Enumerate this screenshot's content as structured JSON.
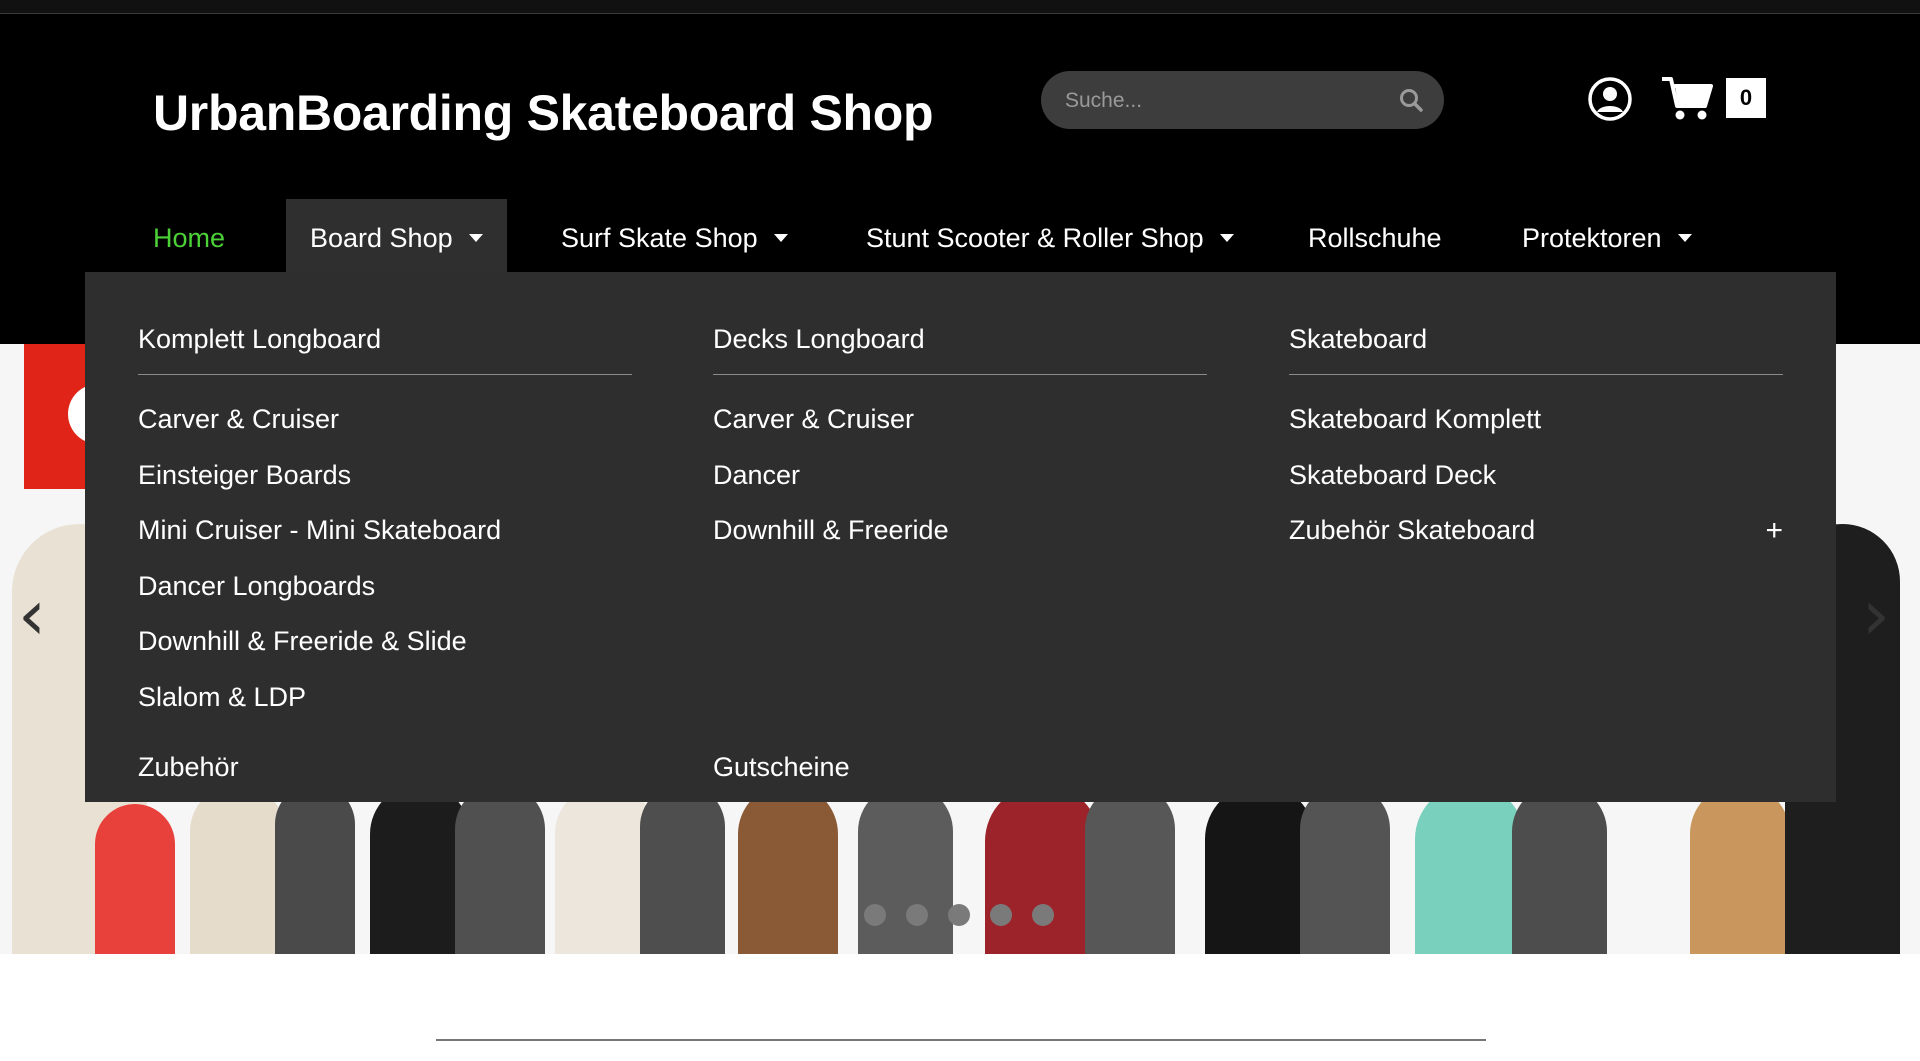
{
  "header": {
    "brand": "UrbanBoarding Skateboard Shop",
    "search_placeholder": "Suche...",
    "cart_count": "0"
  },
  "nav": {
    "items": [
      {
        "label": "Home",
        "active": true
      },
      {
        "label": "Board Shop",
        "dropdown": true,
        "open": true
      },
      {
        "label": "Surf Skate Shop",
        "dropdown": true
      },
      {
        "label": "Stunt Scooter & Roller Shop",
        "dropdown": true
      },
      {
        "label": "Rollschuhe"
      },
      {
        "label": "Protektoren",
        "dropdown": true
      }
    ]
  },
  "mega_menu": {
    "columns": [
      {
        "title": "Komplett Longboard",
        "items": [
          "Carver & Cruiser",
          "Einsteiger Boards",
          "Mini Cruiser - Mini Skateboard",
          "Dancer Longboards",
          "Downhill & Freeride & Slide",
          "Slalom & LDP"
        ]
      },
      {
        "title": "Decks Longboard",
        "items": [
          "Carver & Cruiser",
          "Dancer",
          "Downhill & Freeride"
        ]
      },
      {
        "title": "Skateboard",
        "items": [
          "Skateboard Komplett",
          "Skateboard Deck",
          "Zubehör Skateboard"
        ]
      }
    ],
    "extra": [
      "Zubehör",
      "Gutscheine"
    ],
    "expand_symbol": "+"
  },
  "slider": {
    "prev": "‹",
    "next": "›",
    "dot_count": 5
  },
  "colors": {
    "header_bg": "#000000",
    "menu_bg": "#2e2e2e",
    "active_nav": "#4cd137",
    "search_bg": "#3d3d3d"
  }
}
